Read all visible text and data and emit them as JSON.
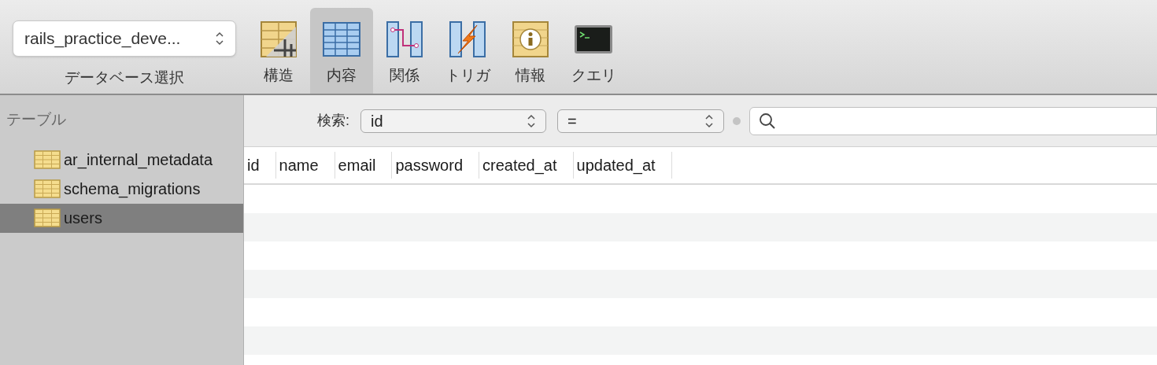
{
  "toolbar": {
    "database_select": {
      "value": "rails_practice_deve...",
      "label": "データベース選択"
    },
    "tools": [
      {
        "kind": "structure",
        "label": "構造",
        "selected": false
      },
      {
        "kind": "content",
        "label": "内容",
        "selected": true
      },
      {
        "kind": "relations",
        "label": "関係",
        "selected": false
      },
      {
        "kind": "triggers",
        "label": "トリガ",
        "selected": false
      },
      {
        "kind": "info",
        "label": "情報",
        "selected": false
      },
      {
        "kind": "query",
        "label": "クエリ",
        "selected": false
      }
    ]
  },
  "sidebar": {
    "heading": "テーブル",
    "items": [
      {
        "name": "ar_internal_metadata",
        "selected": false
      },
      {
        "name": "schema_migrations",
        "selected": false
      },
      {
        "name": "users",
        "selected": true
      }
    ]
  },
  "filter": {
    "label": "検索:",
    "field": "id",
    "operator": "="
  },
  "table": {
    "columns": [
      "id",
      "name",
      "email",
      "password",
      "created_at",
      "updated_at"
    ]
  }
}
